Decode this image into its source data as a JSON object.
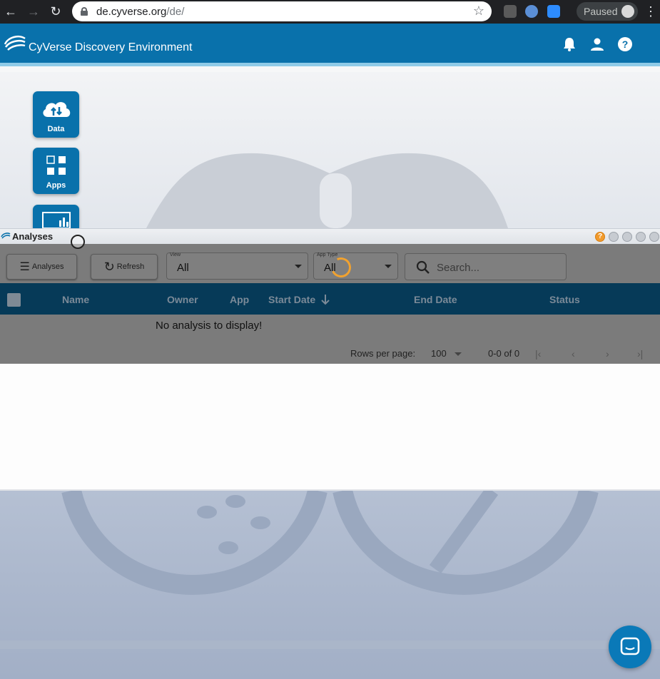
{
  "browser": {
    "url_host": "de.cyverse.org",
    "url_path": "/de/",
    "profile_status": "Paused"
  },
  "header": {
    "title": "CyVerse Discovery Environment"
  },
  "desktop": {
    "icons": [
      {
        "label": "Data"
      },
      {
        "label": "Apps"
      }
    ]
  },
  "analyses_window": {
    "title": "Analyses",
    "menu_button": "Analyses",
    "refresh_button": "Refresh",
    "view_select": {
      "caption": "View",
      "value": "All"
    },
    "app_type_select": {
      "caption": "App Type",
      "value": "All"
    },
    "search_placeholder": "Search...",
    "columns": [
      "Name",
      "Owner",
      "App",
      "Start Date",
      "End Date",
      "Status"
    ],
    "empty_message": "No analysis to display!",
    "pagination": {
      "rows_per_page_label": "Rows per page:",
      "rows_per_page": "100",
      "range": "0-0 of 0"
    }
  },
  "colors": {
    "header": "#0971ab",
    "grid_header": "#063a58",
    "spinner": "#f1a22f"
  }
}
